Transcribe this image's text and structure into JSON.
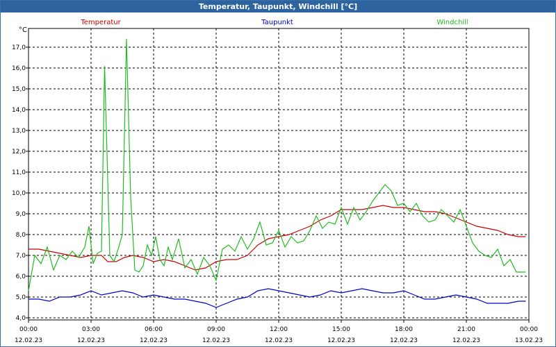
{
  "window": {
    "title": "Temperatur, Taupunkt, Windchill [°C]"
  },
  "chart_data": {
    "type": "line",
    "title": "Temperatur, Taupunkt, Windchill [°C]",
    "ylabel": "°C",
    "ylim": [
      3.9,
      17.9
    ],
    "xlim": [
      0,
      24
    ],
    "yticks": [
      "4,0",
      "5,0",
      "6,0",
      "7,0",
      "8,0",
      "9,0",
      "10,0",
      "11,0",
      "12,0",
      "13,0",
      "14,0",
      "15,0",
      "16,0",
      "17,0"
    ],
    "xticks": [
      {
        "time": "00:00",
        "date": "12.02.23"
      },
      {
        "time": "03:00",
        "date": "12.02.23"
      },
      {
        "time": "06:00",
        "date": "12.02.23"
      },
      {
        "time": "09:00",
        "date": "12.02.23"
      },
      {
        "time": "12:00",
        "date": "12.02.23"
      },
      {
        "time": "15:00",
        "date": "12.02.23"
      },
      {
        "time": "18:00",
        "date": "12.02.23"
      },
      {
        "time": "21:00",
        "date": "12.02.23"
      },
      {
        "time": "00:00",
        "date": "13.02.23"
      }
    ],
    "grid": true,
    "legend_position": "top",
    "x_unit": "hours since 12.02.23 00:00",
    "series": [
      {
        "name": "Temperatur",
        "color": "#cc0000",
        "points": [
          [
            0,
            7.3
          ],
          [
            0.5,
            7.3
          ],
          [
            1,
            7.2
          ],
          [
            1.5,
            7.1
          ],
          [
            2,
            7.0
          ],
          [
            2.5,
            6.9
          ],
          [
            3,
            7.0
          ],
          [
            3.5,
            7.0
          ],
          [
            3.8,
            6.7
          ],
          [
            4.2,
            6.7
          ],
          [
            4.6,
            6.9
          ],
          [
            5,
            7.0
          ],
          [
            5.5,
            6.9
          ],
          [
            6,
            6.7
          ],
          [
            6.5,
            6.8
          ],
          [
            7,
            6.7
          ],
          [
            7.5,
            6.5
          ],
          [
            8,
            6.3
          ],
          [
            8.5,
            6.4
          ],
          [
            9,
            6.7
          ],
          [
            9.5,
            6.8
          ],
          [
            10,
            6.8
          ],
          [
            10.5,
            7.0
          ],
          [
            11,
            7.5
          ],
          [
            11.5,
            7.8
          ],
          [
            12,
            7.9
          ],
          [
            12.5,
            8.0
          ],
          [
            13,
            8.2
          ],
          [
            13.5,
            8.4
          ],
          [
            14,
            8.7
          ],
          [
            14.5,
            8.9
          ],
          [
            15,
            9.2
          ],
          [
            15.5,
            9.2
          ],
          [
            16,
            9.2
          ],
          [
            16.5,
            9.3
          ],
          [
            17,
            9.4
          ],
          [
            17.5,
            9.3
          ],
          [
            18,
            9.3
          ],
          [
            18.5,
            9.2
          ],
          [
            19,
            9.1
          ],
          [
            19.5,
            9.1
          ],
          [
            20,
            9.0
          ],
          [
            20.5,
            8.8
          ],
          [
            21,
            8.6
          ],
          [
            21.5,
            8.4
          ],
          [
            22,
            8.3
          ],
          [
            22.5,
            8.2
          ],
          [
            23,
            8.0
          ],
          [
            23.5,
            7.9
          ],
          [
            23.85,
            7.9
          ]
        ]
      },
      {
        "name": "Taupunkt",
        "color": "#0000cc",
        "points": [
          [
            0,
            4.9
          ],
          [
            0.5,
            4.9
          ],
          [
            1,
            4.8
          ],
          [
            1.5,
            5.0
          ],
          [
            2,
            5.0
          ],
          [
            2.5,
            5.1
          ],
          [
            3,
            5.3
          ],
          [
            3.5,
            5.1
          ],
          [
            4,
            5.2
          ],
          [
            4.5,
            5.3
          ],
          [
            5,
            5.2
          ],
          [
            5.5,
            5.0
          ],
          [
            6,
            5.1
          ],
          [
            6.5,
            5.0
          ],
          [
            7,
            4.9
          ],
          [
            7.5,
            4.9
          ],
          [
            8,
            4.8
          ],
          [
            8.5,
            4.7
          ],
          [
            9,
            4.5
          ],
          [
            9.5,
            4.7
          ],
          [
            10,
            4.9
          ],
          [
            10.5,
            5.0
          ],
          [
            11,
            5.3
          ],
          [
            11.5,
            5.4
          ],
          [
            12,
            5.3
          ],
          [
            12.5,
            5.2
          ],
          [
            13,
            5.1
          ],
          [
            13.5,
            5.0
          ],
          [
            14,
            5.1
          ],
          [
            14.5,
            5.3
          ],
          [
            15,
            5.2
          ],
          [
            15.5,
            5.3
          ],
          [
            16,
            5.4
          ],
          [
            16.5,
            5.3
          ],
          [
            17,
            5.2
          ],
          [
            17.5,
            5.2
          ],
          [
            18,
            5.3
          ],
          [
            18.5,
            5.1
          ],
          [
            19,
            4.9
          ],
          [
            19.5,
            4.9
          ],
          [
            20,
            5.0
          ],
          [
            20.5,
            5.1
          ],
          [
            21,
            5.0
          ],
          [
            21.5,
            4.9
          ],
          [
            22,
            4.7
          ],
          [
            22.5,
            4.7
          ],
          [
            23,
            4.7
          ],
          [
            23.5,
            4.8
          ],
          [
            23.85,
            4.8
          ]
        ]
      },
      {
        "name": "Windchill",
        "color": "#22bb22",
        "points": [
          [
            0,
            5.3
          ],
          [
            0.3,
            7.0
          ],
          [
            0.6,
            6.6
          ],
          [
            0.9,
            7.4
          ],
          [
            1.2,
            6.3
          ],
          [
            1.5,
            7.0
          ],
          [
            1.8,
            6.8
          ],
          [
            2.1,
            7.2
          ],
          [
            2.4,
            6.9
          ],
          [
            2.7,
            7.4
          ],
          [
            2.9,
            8.4
          ],
          [
            3.1,
            6.6
          ],
          [
            3.3,
            7.1
          ],
          [
            3.5,
            7.2
          ],
          [
            3.65,
            16.1
          ],
          [
            3.9,
            7.0
          ],
          [
            4.1,
            6.7
          ],
          [
            4.3,
            7.3
          ],
          [
            4.5,
            8.0
          ],
          [
            4.7,
            17.4
          ],
          [
            4.9,
            9.8
          ],
          [
            5.1,
            6.3
          ],
          [
            5.3,
            6.2
          ],
          [
            5.5,
            6.5
          ],
          [
            5.7,
            7.5
          ],
          [
            5.9,
            7.0
          ],
          [
            6.1,
            7.9
          ],
          [
            6.3,
            6.8
          ],
          [
            6.5,
            6.5
          ],
          [
            6.7,
            7.4
          ],
          [
            6.9,
            6.8
          ],
          [
            7.2,
            7.8
          ],
          [
            7.5,
            6.4
          ],
          [
            7.8,
            6.8
          ],
          [
            8.1,
            6.1
          ],
          [
            8.4,
            6.9
          ],
          [
            8.7,
            6.5
          ],
          [
            9.0,
            5.8
          ],
          [
            9.3,
            7.3
          ],
          [
            9.6,
            7.5
          ],
          [
            9.9,
            7.2
          ],
          [
            10.2,
            7.9
          ],
          [
            10.5,
            7.3
          ],
          [
            10.8,
            7.8
          ],
          [
            11.1,
            8.6
          ],
          [
            11.4,
            7.5
          ],
          [
            11.7,
            7.6
          ],
          [
            12.0,
            8.2
          ],
          [
            12.3,
            7.4
          ],
          [
            12.6,
            7.9
          ],
          [
            12.9,
            7.6
          ],
          [
            13.2,
            7.7
          ],
          [
            13.5,
            8.2
          ],
          [
            13.8,
            8.9
          ],
          [
            14.1,
            8.3
          ],
          [
            14.4,
            8.6
          ],
          [
            14.7,
            8.5
          ],
          [
            15.0,
            9.3
          ],
          [
            15.3,
            8.5
          ],
          [
            15.6,
            9.3
          ],
          [
            15.9,
            8.7
          ],
          [
            16.2,
            9.1
          ],
          [
            16.5,
            9.6
          ],
          [
            16.8,
            10.0
          ],
          [
            17.1,
            10.4
          ],
          [
            17.4,
            10.1
          ],
          [
            17.7,
            9.4
          ],
          [
            18.0,
            9.5
          ],
          [
            18.3,
            9.1
          ],
          [
            18.6,
            9.5
          ],
          [
            18.9,
            8.9
          ],
          [
            19.2,
            8.6
          ],
          [
            19.5,
            8.7
          ],
          [
            19.8,
            9.2
          ],
          [
            20.1,
            8.9
          ],
          [
            20.4,
            8.6
          ],
          [
            20.7,
            9.2
          ],
          [
            21.0,
            8.4
          ],
          [
            21.3,
            7.6
          ],
          [
            21.6,
            7.2
          ],
          [
            21.9,
            7.0
          ],
          [
            22.2,
            6.9
          ],
          [
            22.5,
            7.3
          ],
          [
            22.8,
            6.5
          ],
          [
            23.1,
            6.8
          ],
          [
            23.4,
            6.2
          ],
          [
            23.7,
            6.2
          ],
          [
            23.85,
            6.2
          ]
        ]
      }
    ]
  }
}
